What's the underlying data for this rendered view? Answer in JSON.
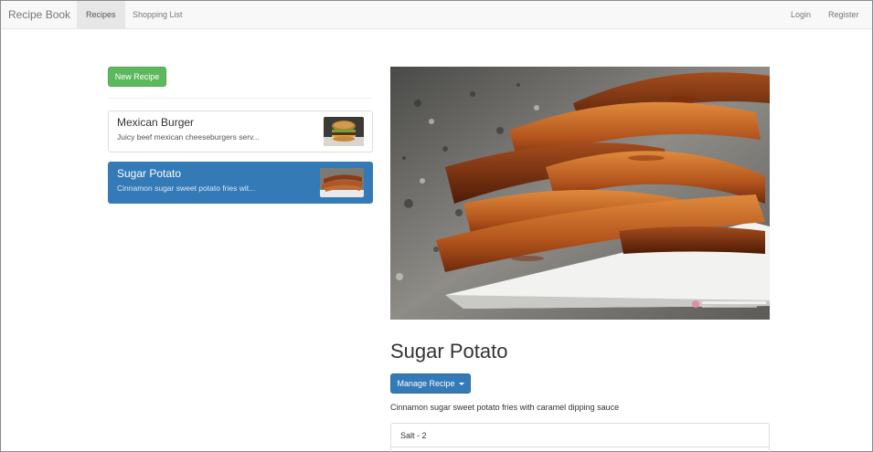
{
  "navbar": {
    "brand": "Recipe Book",
    "tabs": [
      {
        "label": "Recipes",
        "active": true
      },
      {
        "label": "Shopping List",
        "active": false
      }
    ],
    "right": [
      {
        "label": "Login"
      },
      {
        "label": "Register"
      }
    ]
  },
  "sidebar": {
    "new_recipe_label": "New Recipe",
    "recipes": [
      {
        "name": "Mexican Burger",
        "description": "Juicy beef mexican cheeseburgers serv...",
        "active": false,
        "thumbnail": "burger-thumbnail"
      },
      {
        "name": "Sugar Potato",
        "description": "Cinnamon sugar sweet potato fries wit...",
        "active": true,
        "thumbnail": "sweet-potato-thumbnail"
      }
    ]
  },
  "detail": {
    "image": "sweet-potato-fries-photo",
    "title": "Sugar Potato",
    "manage_label": "Manage Recipe",
    "description": "Cinnamon sugar sweet potato fries with caramel dipping sauce",
    "ingredients": [
      "Salt - 2"
    ]
  },
  "colors": {
    "navbar_bg": "#f8f8f8",
    "success": "#5cb85c",
    "primary": "#337ab7"
  }
}
